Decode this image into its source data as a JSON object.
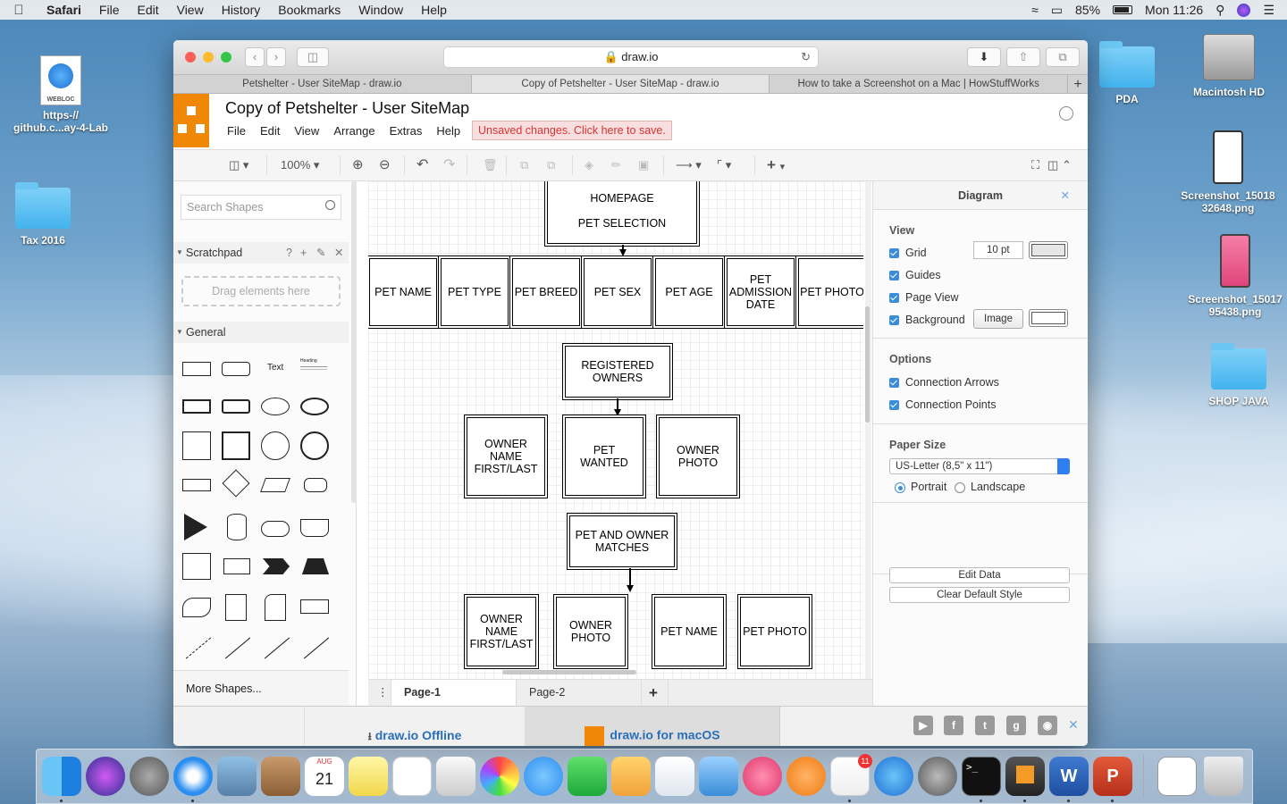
{
  "menubar": {
    "items": [
      "Safari",
      "File",
      "Edit",
      "View",
      "History",
      "Bookmarks",
      "Window",
      "Help"
    ],
    "battery": "85%",
    "clock": "Mon 11:26"
  },
  "desktop": {
    "left_icons": [
      {
        "label": "https-//\ngithub.c...ay-4-Lab",
        "badge": "WEBLOC"
      },
      {
        "label": "Tax 2016"
      }
    ],
    "right_icons": [
      {
        "label": "PDA"
      },
      {
        "label": "Macintosh HD"
      },
      {
        "label": "Screenshot_15018\n32648.png"
      },
      {
        "label": "Screenshot_15017\n95438.png"
      },
      {
        "label": "SHOP JAVA"
      }
    ]
  },
  "browser": {
    "url": "draw.io",
    "tabs": [
      "Petshelter - User SiteMap - draw.io",
      "Copy of Petshelter - User SiteMap - draw.io",
      "How to take a Screenshot on a Mac | HowStuffWorks"
    ]
  },
  "app": {
    "doc_title": "Copy of Petshelter - User SiteMap",
    "menu": [
      "File",
      "Edit",
      "View",
      "Arrange",
      "Extras",
      "Help"
    ],
    "unsaved": "Unsaved changes. Click here to save.",
    "zoom": "100%"
  },
  "left_panel": {
    "search_placeholder": "Search Shapes",
    "scratchpad": "Scratchpad",
    "scratchpad_help": "?",
    "drop_hint": "Drag elements here",
    "general": "General",
    "text_shape": "Text",
    "heading_shape": "Heading",
    "more_shapes": "More Shapes..."
  },
  "diagram": {
    "homepage": "HOMEPAGE\n\nPET SELECTION",
    "pet_fields": [
      "PET NAME",
      "PET TYPE",
      "PET BREED",
      "PET SEX",
      "PET AGE",
      "PET\nADMISSION\nDATE",
      "PET PHOTO"
    ],
    "registered_owners": "REGISTERED\nOWNERS",
    "owner_row": [
      "OWNER\nNAME\nFIRST/LAST",
      "PET\nWANTED",
      "OWNER\nPHOTO"
    ],
    "matches": "PET AND OWNER\nMATCHES",
    "match_row": [
      "OWNER\nNAME\nFIRST/LAST",
      "OWNER\nPHOTO",
      "PET NAME",
      "PET PHOTO"
    ]
  },
  "pages": [
    "Page-1",
    "Page-2"
  ],
  "right_panel": {
    "title": "Diagram",
    "view_title": "View",
    "view_options": [
      "Grid",
      "Guides",
      "Page View",
      "Background"
    ],
    "grid_size": "10 pt",
    "image_button": "Image",
    "options_title": "Options",
    "options": [
      "Connection Arrows",
      "Connection Points"
    ],
    "paper_title": "Paper Size",
    "paper_value": "US-Letter (8,5\" x 11\")",
    "portrait": "Portrait",
    "landscape": "Landscape",
    "edit_data": "Edit Data",
    "clear_style": "Clear Default Style"
  },
  "bottom": {
    "offline": "draw.io Offline",
    "macos": "draw.io for macOS"
  },
  "dock": {
    "calendar_month": "AUG",
    "calendar_day": "21",
    "badge": "11"
  },
  "colors": {
    "drawio_orange": "#f08705",
    "accent_blue": "#3a8dd8",
    "unsaved_red": "#d33333"
  }
}
